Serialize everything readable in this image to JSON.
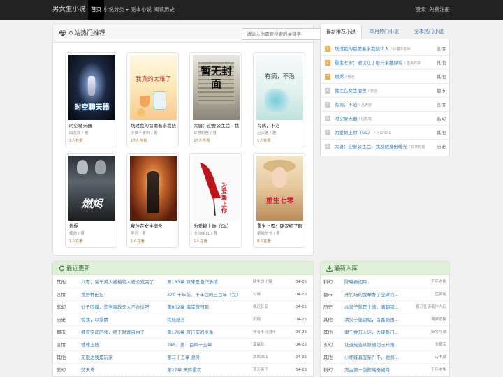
{
  "nav": {
    "brand": "男女生小说",
    "items": [
      {
        "label": "首页",
        "active": true
      },
      {
        "label": "小说分类",
        "dropdown": true
      },
      {
        "label": "完本小说"
      },
      {
        "label": "阅读历史"
      }
    ],
    "login": "登录",
    "register": "免费注册"
  },
  "hot": {
    "title": "本站热门推荐",
    "search_placeholder": "请输入你需要搜索的关键字",
    "search_button": "搜索",
    "books": [
      {
        "title": "时空聊天器",
        "author": "回龙寂 / 著",
        "readers": "1人在看",
        "cover_text": "时空聊天器"
      },
      {
        "title": "坑过我的都跪着求我饶",
        "author": "小猫不爱叫 / 著",
        "readers": "17人在看",
        "cover_text": "我真的太难了"
      },
      {
        "title": "大唐：迎娶公主后，我",
        "author": "甘蔗奶爸 / 著",
        "readers": "17人在看",
        "cover_text": "暂无封面"
      },
      {
        "title": "有病，不治",
        "author": "吕天逸 / 著",
        "readers": "1人在看",
        "cover_text": "有病，不治"
      },
      {
        "title": "燃烬",
        "author": "桉池 / 著",
        "readers": "1人在看",
        "cover_text": "燃烬"
      },
      {
        "title": "我住在女生宿舍",
        "author": "李滔 / 著",
        "readers": "1人在看",
        "cover_text": ""
      },
      {
        "title": "为爱赖上你（GL）",
        "author": "小白NO1 / 著",
        "readers": "1人在看",
        "cover_text": "为爱赖上你"
      },
      {
        "title": "重生七零：硬汉红了眼",
        "author": "墨染的书 / 著",
        "readers": "8人在看",
        "cover_text": "重生七零"
      }
    ]
  },
  "ranking": {
    "tabs": [
      "最新推荐小说",
      "本月热门小说",
      "全本热门小说"
    ],
    "items": [
      {
        "num": "1",
        "title": "坑过我的都跪着求我饶个人",
        "author": "/ 小猫不爱叫",
        "genre": "言情"
      },
      {
        "num": "2",
        "title": "重生七零：硬汉红了眼只求她原谅",
        "author": "/ 墨染的书",
        "genre": "其他"
      },
      {
        "num": "3",
        "title": "燃烬",
        "author": "/ 桉池",
        "genre": "其他"
      },
      {
        "num": "4",
        "title": "我住在女生宿舍",
        "author": "/ 李滔",
        "genre": "都市"
      },
      {
        "num": "5",
        "title": "有病，不治",
        "author": "/ 吕天逸",
        "genre": "言情"
      },
      {
        "num": "6",
        "title": "时空聊天器",
        "author": "/ 回龙寂",
        "genre": "玄幻"
      },
      {
        "num": "7",
        "title": "为爱赖上你（GL）",
        "author": "/ 小白NO1",
        "genre": "其他"
      },
      {
        "num": "8",
        "title": "大唐：迎娶公主后，我反贼身份曝光",
        "author": "/ 甘蔗奶爸",
        "genre": "历史"
      }
    ]
  },
  "updates": {
    "title": "最近更新",
    "rows": [
      {
        "cat": "其他",
        "book": "八零，易孕美人被植物人老公宠哭了",
        "chapter": "第183章 原来是自作多情",
        "author": "陆生的小猫",
        "date": "04-25"
      },
      {
        "cat": "言情",
        "book": "荒野种田记",
        "chapter": "270 千年前、千年后的三百年（完）",
        "author": "匀城",
        "date": "04-25"
      },
      {
        "cat": "玄幻",
        "book": "仙子同媒，您当魔教夫人不合适吧",
        "chapter": "第802章 海岸旅归眼",
        "author": "枫迟长安",
        "date": "04-25"
      },
      {
        "cat": "历史",
        "book": "惊我，以爱情",
        "chapter": "完结感言",
        "author": "沉砚",
        "date": "04-25"
      },
      {
        "cat": "都市",
        "book": "拥有空间的我，终于财富自由了",
        "chapter": "第176章 旅行前的准备",
        "author": "作者不马消年",
        "date": "04-25"
      },
      {
        "cat": "言情",
        "book": "地球上线",
        "chapter": "245、第二百四十五章",
        "author": "莫晨欢",
        "date": "04-25"
      },
      {
        "cat": "其他",
        "book": "无限之我是玩家",
        "chapter": "第二十五章 意外",
        "author": "西陌001",
        "date": "04-25"
      },
      {
        "cat": "玄幻",
        "book": "焚天塔",
        "chapter": "第27章 天降雷罚",
        "author": "道天笑子",
        "date": "04-25"
      }
    ]
  },
  "newbooks": {
    "title": "最新入库",
    "rows": [
      {
        "cat": "科幻",
        "book": "陈曦秦如月",
        "author": "千年老龟"
      },
      {
        "cat": "都市",
        "book": "开钓场的我举办了全球钓...",
        "author": "空梦峻"
      },
      {
        "cat": "历史",
        "book": "本皇子就是个渣，满朝都...",
        "author": "百万任读者作人口"
      },
      {
        "cat": "其他",
        "book": "清父子靠边站，首富奶团...",
        "author": "满英道楼"
      },
      {
        "cat": "其他",
        "book": "假千金万人迷，大佬整门...",
        "author": "酥兮吟录"
      },
      {
        "cat": "玄幻",
        "book": "证道成圣从原创功法开始",
        "author": "多耀宗"
      },
      {
        "cat": "其他",
        "book": "小师妹真废柴？不，她努...",
        "author": "Ly木真"
      },
      {
        "cat": "科幻",
        "book": "万古第一剑陈曦秦如月",
        "author": "千年老龟"
      }
    ]
  },
  "colors": {
    "accent": "#337ab7",
    "navbar": "#222222",
    "section_green": "#dff0d8"
  }
}
